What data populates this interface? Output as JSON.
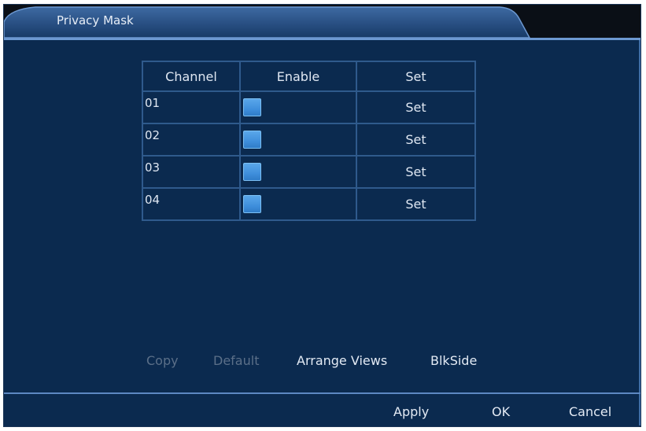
{
  "window": {
    "title": "Privacy Mask"
  },
  "table": {
    "headers": [
      "Channel",
      "Enable",
      "Set"
    ],
    "rows": [
      {
        "channel": "01",
        "enabled": true,
        "set_label": "Set"
      },
      {
        "channel": "02",
        "enabled": true,
        "set_label": "Set"
      },
      {
        "channel": "03",
        "enabled": true,
        "set_label": "Set"
      },
      {
        "channel": "04",
        "enabled": true,
        "set_label": "Set"
      }
    ]
  },
  "actions": {
    "copy": "Copy",
    "default": "Default",
    "arrange_views": "Arrange Views",
    "blkside": "BlkSide"
  },
  "footer": {
    "apply": "Apply",
    "ok": "OK",
    "cancel": "Cancel"
  },
  "colors": {
    "panel_bg": "#0b2a4f",
    "accent_line": "#6c98d1",
    "checkbox": "#4a9ae3",
    "disabled_text": "#5b6f88"
  }
}
